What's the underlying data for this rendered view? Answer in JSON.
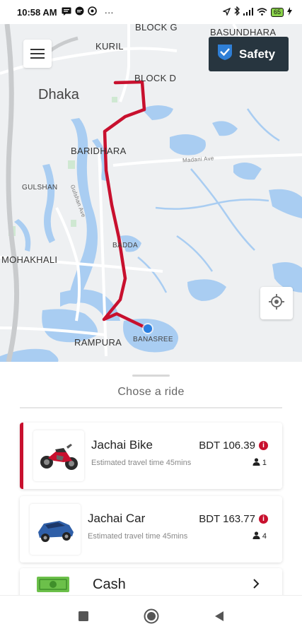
{
  "status_bar": {
    "time": "10:58 AM",
    "ellipsis": "···",
    "battery": "65",
    "left_icons": [
      "message-icon",
      "chat-icon",
      "settings-icon"
    ],
    "right_icons": [
      "location-icon",
      "bluetooth-icon",
      "signal-icon",
      "wifi-icon",
      "battery-icon",
      "charging-icon"
    ]
  },
  "map": {
    "labels": {
      "block_g": "BLOCK G",
      "basundhara": "BASUNDHARA",
      "kuril": "KURIL",
      "block_d": "BLOCK D",
      "dhaka": "Dhaka",
      "baridhara": "BARIDHARA",
      "madani_ave": "Madani Ave",
      "gulshan": "GULSHAN",
      "gulshan_ave": "Gulshan Ave",
      "badda": "BADDA",
      "mohakhali": "MOHAKHALI",
      "rampura": "RAMPURA",
      "banasree": "BANASREE"
    },
    "route_color": "#c8102e",
    "origin_color": "#2a7fe0"
  },
  "safety_button": {
    "label": "Safety",
    "accent": "#27353f"
  },
  "sheet": {
    "title": "Chose a ride",
    "rides": [
      {
        "name": "Jachai Bike",
        "eta": "Estimated travel time 45mins",
        "price": "BDT 106.39",
        "seats": "1",
        "icon": "motorbike-icon",
        "selected": true
      },
      {
        "name": "Jachai Car",
        "eta": "Estimated travel time 45mins",
        "price": "BDT 163.77",
        "seats": "4",
        "icon": "car-icon",
        "selected": false
      }
    ],
    "payment": {
      "label": "Cash",
      "icon": "cash-icon"
    }
  },
  "accent": "#c8102e"
}
